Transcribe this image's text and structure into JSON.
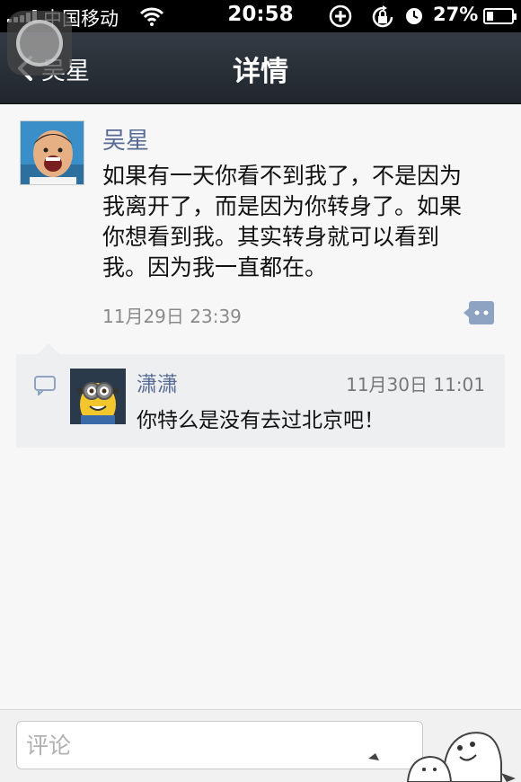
{
  "status_bar": {
    "carrier": "中国移动",
    "time": "20:58",
    "battery_pct": "27%",
    "battery_level": 0.27,
    "icons": [
      "signal-icon",
      "wifi-icon",
      "plus-circle-icon",
      "rotation-lock-icon",
      "alarm-icon",
      "battery-icon"
    ]
  },
  "nav": {
    "back_label": "吴星",
    "title": "详情"
  },
  "post": {
    "author": "吴星",
    "text": "如果有一天你看不到我了，不是因为我离开了，而是因为你转身了。如果你想看到我。其实转身就可以看到我。因为我一直都在。",
    "time": "11月29日 23:39"
  },
  "comments": [
    {
      "name": "潇潇",
      "time": "11月30日 11:01",
      "text": "你特么是没有去过北京吧！"
    }
  ],
  "input": {
    "placeholder": "评论"
  },
  "colors": {
    "link_blue": "#576b95",
    "nav_bg": "#2b3138",
    "comment_bg": "#eeeff1"
  }
}
